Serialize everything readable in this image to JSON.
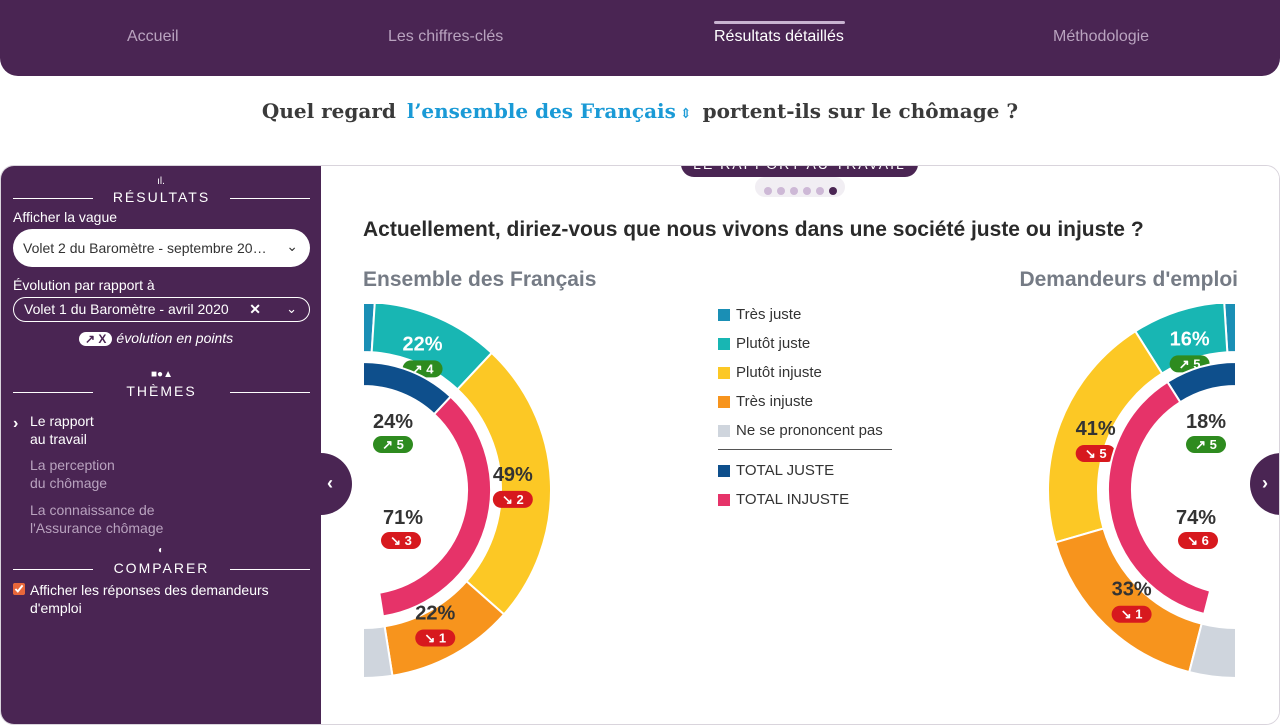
{
  "nav": {
    "items": [
      {
        "label": "Accueil"
      },
      {
        "label": "Les chiffres-clés"
      },
      {
        "label": "Résultats détaillés"
      },
      {
        "label": "Méthodologie"
      }
    ]
  },
  "question": {
    "before": "Quel regard",
    "population": "l’ensemble des Français",
    "after": "portent-ils sur le chômage ?"
  },
  "sidebar": {
    "results_title": "RÉSULTATS",
    "wave_label": "Afficher la vague",
    "wave_value": "Volet 2 du Baromètre - septembre 20…",
    "compare_label": "Évolution par rapport à",
    "compare_value": "Volet 1 du Baromètre - avril 2020",
    "evo_pill": "↗ X",
    "evo_legend": "évolution en points",
    "themes_title": "THÈMES",
    "themes": [
      {
        "line1": "Le rapport",
        "line2": "au travail"
      },
      {
        "line1": "La perception",
        "line2": "du chômage"
      },
      {
        "line1": "La connaissance de",
        "line2": "l'Assurance chômage"
      }
    ],
    "compare_title": "COMPARER",
    "compare_checkbox_label": "Afficher les réponses des demandeurs d'emploi"
  },
  "content": {
    "theme_badge": "LE RAPPORT AU TRAVAIL",
    "question_title": "Actuellement, diriez-vous que nous vivons dans une société juste ou injuste ?"
  },
  "colors": {
    "purple": "#4a2553",
    "tres_juste": "#1a8fb5",
    "plutot_juste": "#18b6b3",
    "plutot_injuste": "#fcc825",
    "tres_injuste": "#f7941d",
    "nsp": "#cfd5dd",
    "total_juste": "#0e4f8c",
    "total_injuste": "#e63369",
    "up": "#2e8b1f",
    "down": "#d7191e"
  },
  "chart_data": [
    {
      "type": "pie",
      "title": "Ensemble des Français",
      "categories": [
        "Très juste",
        "Plutôt juste",
        "Plutôt injuste",
        "Très injuste",
        "Ne se prononcent pas"
      ],
      "values": [
        2,
        22,
        49,
        22,
        5
      ],
      "labels": [
        "",
        "22%",
        "49%",
        "22%",
        ""
      ],
      "evolutions": [
        null,
        {
          "dir": "up",
          "text": "4"
        },
        {
          "dir": "down",
          "text": "2"
        },
        {
          "dir": "down",
          "text": "1"
        },
        null
      ],
      "totals": [
        {
          "name": "TOTAL JUSTE",
          "value": 24,
          "label": "24%",
          "evolution": {
            "dir": "up",
            "text": "5"
          }
        },
        {
          "name": "TOTAL INJUSTE",
          "value": 71,
          "label": "71%",
          "evolution": {
            "dir": "down",
            "text": "3"
          }
        }
      ]
    },
    {
      "type": "pie",
      "title": "Demandeurs d'emploi",
      "categories": [
        "Très juste",
        "Plutôt juste",
        "Plutôt injuste",
        "Très injuste",
        "Ne se prononcent pas"
      ],
      "values": [
        2,
        16,
        41,
        33,
        8
      ],
      "labels": [
        "",
        "16%",
        "41%",
        "33%",
        ""
      ],
      "evolutions": [
        null,
        {
          "dir": "up",
          "text": "5"
        },
        {
          "dir": "down",
          "text": "5"
        },
        {
          "dir": "down",
          "text": "1"
        },
        null
      ],
      "totals": [
        {
          "name": "TOTAL JUSTE",
          "value": 18,
          "label": "18%",
          "evolution": {
            "dir": "up",
            "text": "5"
          }
        },
        {
          "name": "TOTAL INJUSTE",
          "value": 74,
          "label": "74%",
          "evolution": {
            "dir": "down",
            "text": "6"
          }
        }
      ]
    }
  ],
  "legend": {
    "items": [
      {
        "label": "Très juste"
      },
      {
        "label": "Plutôt juste"
      },
      {
        "label": "Plutôt injuste"
      },
      {
        "label": "Très injuste"
      },
      {
        "label": "Ne se prononcent pas"
      }
    ],
    "totals": [
      {
        "label": "TOTAL JUSTE"
      },
      {
        "label": "TOTAL INJUSTE"
      }
    ]
  }
}
